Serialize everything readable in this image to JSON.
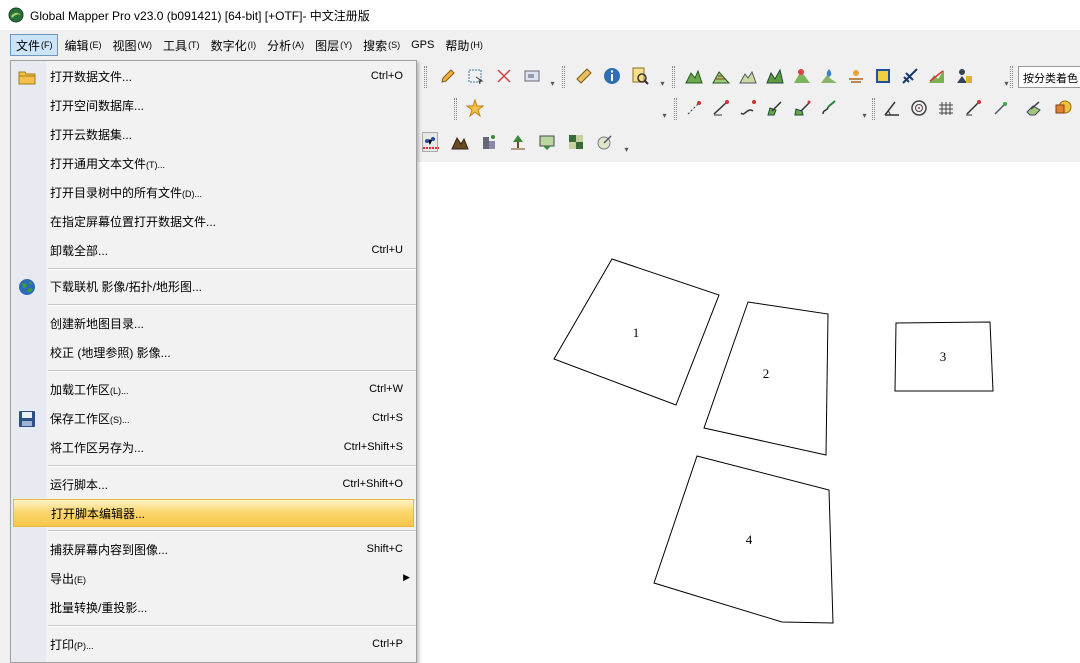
{
  "window": {
    "title": "Global Mapper Pro v23.0 (b091421) [64-bit] [+OTF]- 中文注册版",
    "logo_icon": "globe-logo-icon"
  },
  "menubar": [
    {
      "label": "文件",
      "acc": "(F)"
    },
    {
      "label": "编辑",
      "acc": "(E)"
    },
    {
      "label": "视图",
      "acc": "(W)"
    },
    {
      "label": "工具",
      "acc": "(T)"
    },
    {
      "label": "数字化",
      "acc": "(I)"
    },
    {
      "label": "分析",
      "acc": "(A)"
    },
    {
      "label": "图层",
      "acc": "(Y)"
    },
    {
      "label": "搜索",
      "acc": "(S)"
    },
    {
      "label": "GPS",
      "acc": ""
    },
    {
      "label": "帮助",
      "acc": "(H)"
    }
  ],
  "toolbar": {
    "combo_value": "按分类着色"
  },
  "file_menu": {
    "items": [
      {
        "label": "打开数据文件...",
        "acc": "",
        "shortcut": "Ctrl+O",
        "icon": "open-folder-icon"
      },
      {
        "label": "打开空间数据库...",
        "acc": "",
        "shortcut": ""
      },
      {
        "label": "打开云数据集...",
        "acc": "",
        "shortcut": ""
      },
      {
        "label": "打开通用文本文件",
        "acc": "(T)...",
        "shortcut": ""
      },
      {
        "label": "打开目录树中的所有文件",
        "acc": "(D)...",
        "shortcut": ""
      },
      {
        "label": "在指定屏幕位置打开数据文件...",
        "acc": "",
        "shortcut": ""
      },
      {
        "label": "卸载全部...",
        "acc": "",
        "shortcut": "Ctrl+U"
      },
      {
        "label": "下载联机 影像/拓扑/地形图...",
        "acc": "",
        "shortcut": "",
        "icon": "globe-icon"
      },
      {
        "label": "创建新地图目录...",
        "acc": "",
        "shortcut": ""
      },
      {
        "label": "校正 (地理参照) 影像...",
        "acc": "",
        "shortcut": ""
      },
      {
        "label": "加载工作区",
        "acc": "(L)...",
        "shortcut": "Ctrl+W"
      },
      {
        "label": "保存工作区",
        "acc": "(S)...",
        "shortcut": "Ctrl+S",
        "icon": "save-disk-icon"
      },
      {
        "label": "将工作区另存为...",
        "acc": "",
        "shortcut": "Ctrl+Shift+S"
      },
      {
        "label": "运行脚本...",
        "acc": "",
        "shortcut": "Ctrl+Shift+O"
      },
      {
        "label": "打开脚本编辑器...",
        "acc": "",
        "shortcut": ""
      },
      {
        "label": "捕获屏幕内容到图像...",
        "acc": "",
        "shortcut": "Shift+C"
      },
      {
        "label": "导出",
        "acc": "(E)",
        "shortcut": ""
      },
      {
        "label": "批量转换/重投影...",
        "acc": "",
        "shortcut": ""
      },
      {
        "label": "打印",
        "acc": "(P)...",
        "shortcut": "Ctrl+P"
      }
    ]
  },
  "map": {
    "features": [
      {
        "label": "1"
      },
      {
        "label": "2"
      },
      {
        "label": "3"
      },
      {
        "label": "4"
      }
    ]
  },
  "colors": {
    "highlight": "#f7c64a",
    "menu_bg": "#f2f2f2",
    "gutter": "#e7eaf0",
    "polygon_stroke": "#000000"
  }
}
